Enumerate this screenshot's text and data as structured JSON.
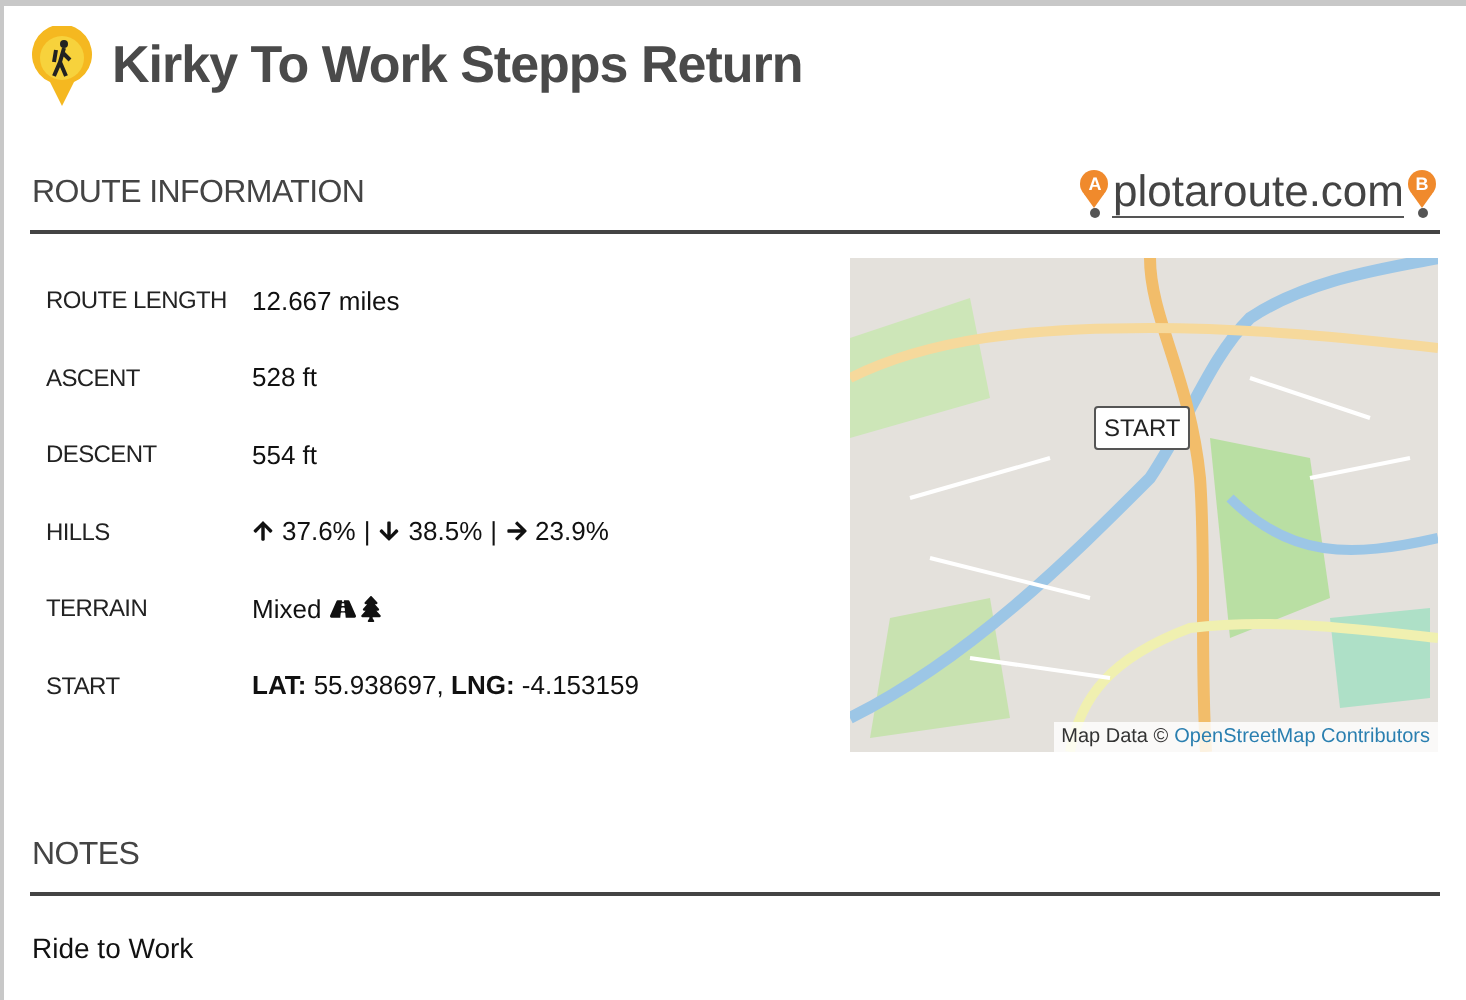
{
  "title": "Kirky To Work Stepps Return",
  "route_information": {
    "heading": "ROUTE INFORMATION",
    "logo": {
      "text": "plotaroute.com",
      "start_pin": "A",
      "end_pin": "B"
    },
    "rows": [
      {
        "kind": "text",
        "label": "ROUTE LENGTH",
        "value": "12.667 miles"
      },
      {
        "kind": "text",
        "label": "ASCENT",
        "value": "528 ft"
      },
      {
        "kind": "text",
        "label": "DESCENT",
        "value": "554 ft"
      },
      {
        "kind": "hills",
        "label": "HILLS",
        "parts": [
          {
            "kind": "up",
            "value": "37.6%"
          },
          {
            "kind": "down",
            "value": "38.5%"
          },
          {
            "kind": "flat",
            "value": "23.9%"
          }
        ],
        "separator": "|"
      },
      {
        "kind": "terrain",
        "label": "TERRAIN",
        "value": "Mixed"
      },
      {
        "kind": "rich",
        "label": "START",
        "value": "**LAT:** 55.938697, **LNG:** -4.153159"
      }
    ],
    "map": {
      "marker": "START",
      "attribution": "Map Data ©",
      "attribution_link": "OpenStreetMap Contributors"
    }
  },
  "notes": {
    "heading": "NOTES",
    "text": "Ride to Work"
  }
}
